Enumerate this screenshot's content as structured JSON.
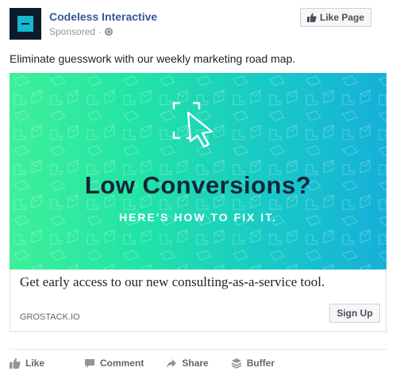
{
  "post": {
    "page_name": "Codeless Interactive",
    "sponsored_label": "Sponsored",
    "sponsored_separator": "·",
    "like_page_label": "Like Page",
    "text": "Eliminate guesswork with our weekly marketing road map."
  },
  "ad": {
    "title": "Low Conversions?",
    "subtitle": "HERE'S HOW TO FIX IT.",
    "headline": "Get early access to our new consulting-as-a-service tool.",
    "domain": "GROSTACK.IO",
    "cta_label": "Sign Up",
    "gradient_colors": [
      "#3ef09a",
      "#16b0d8"
    ],
    "title_color": "#14253a"
  },
  "actions": [
    {
      "label": "Like",
      "icon": "thumbs-up-icon"
    },
    {
      "label": "Comment",
      "icon": "comment-icon"
    },
    {
      "label": "Share",
      "icon": "share-icon"
    },
    {
      "label": "Buffer",
      "icon": "buffer-icon"
    }
  ],
  "colors": {
    "link_blue": "#365899",
    "muted_text": "#90949c",
    "avatar_bg": "#0d1b2a",
    "avatar_accent": "#16b7d2"
  }
}
